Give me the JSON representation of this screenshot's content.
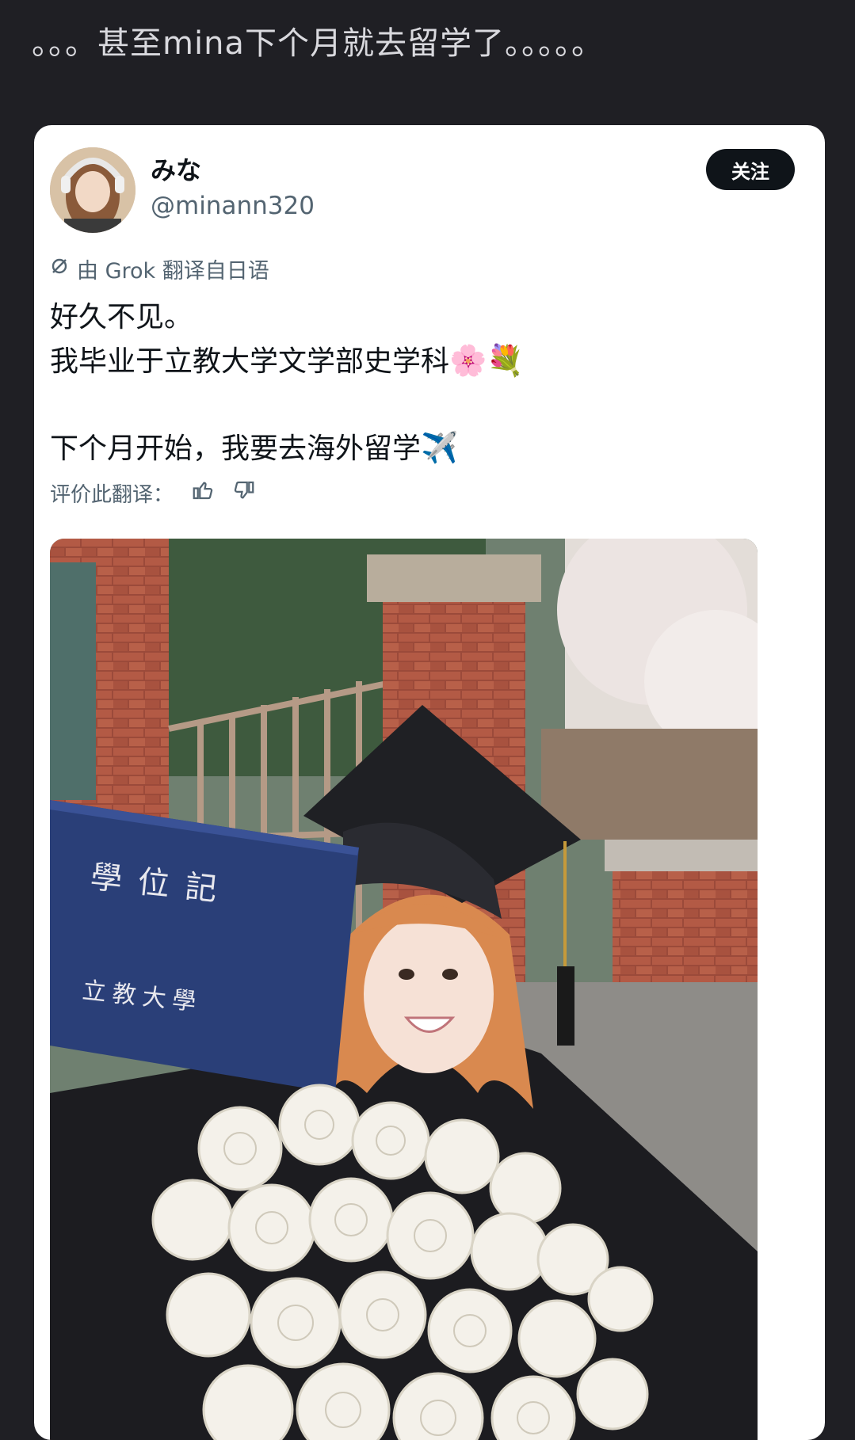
{
  "caption": "。。。甚至mina下个月就去留学了。。。。。",
  "tweet": {
    "display_name": "みな",
    "handle": "@minann320",
    "follow_label": "关注",
    "translated_label": "由 Grok 翻译自日语",
    "lines": [
      "好久不见。",
      "我毕业于立教大学文学部史学科"
    ],
    "line3": "下个月开始，我要去海外留学",
    "emoji_flowers": "🌸💐",
    "emoji_plane": "✈️",
    "rate_label": "评价此翻译："
  },
  "photo": {
    "diploma_title": "學位記",
    "diploma_school": "立教大學"
  },
  "icons": [
    "grok-icon",
    "thumbs-up-icon",
    "thumbs-down-icon"
  ]
}
